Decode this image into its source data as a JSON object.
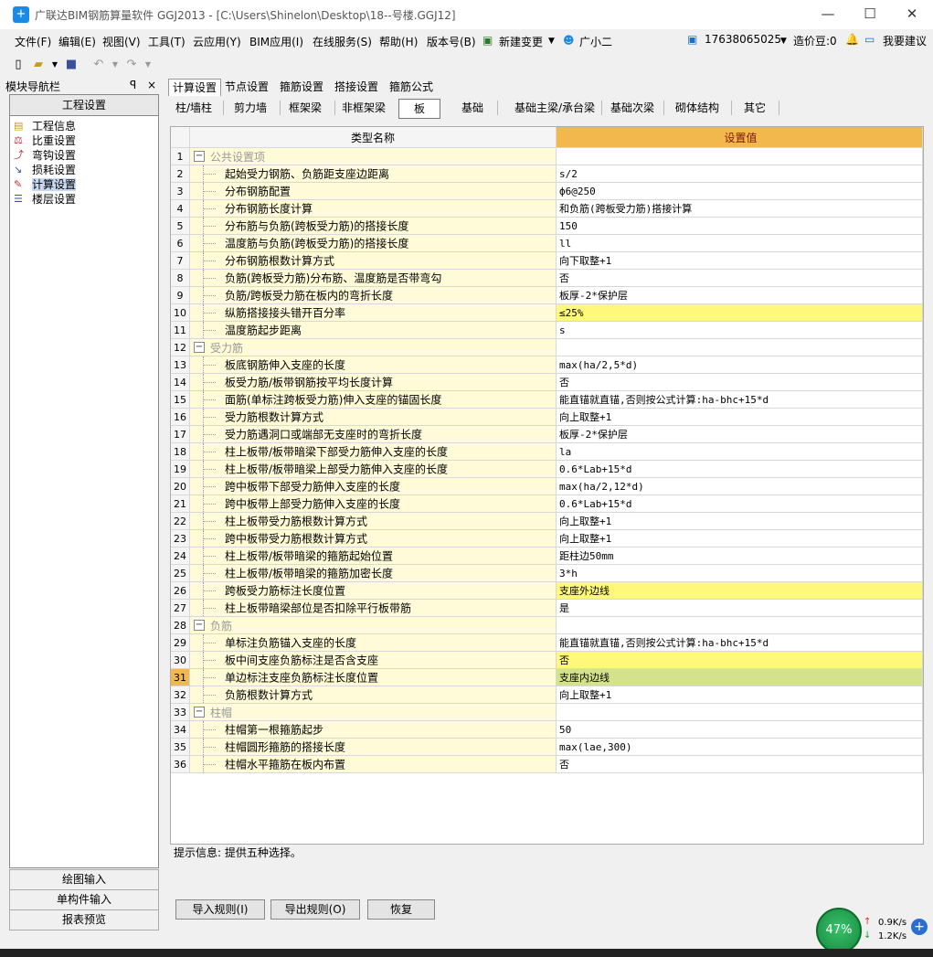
{
  "window": {
    "title": "广联达BIM钢筋算量软件 GGJ2013 - [C:\\Users\\Shinelon\\Desktop\\18--号楼.GGJ12]",
    "minimize": "—",
    "maximize": "☐",
    "close": "✕"
  },
  "menu": {
    "items": [
      "文件(F)",
      "编辑(E)",
      "视图(V)",
      "工具(T)",
      "云应用(Y)",
      "BIM应用(I)",
      "在线服务(S)",
      "帮助(H)",
      "版本号(B)",
      "新建变更",
      "广小二"
    ],
    "phone": "17638065025",
    "beans": "造价豆:0",
    "suggest": "我要建议"
  },
  "nav": {
    "title": "模块导航栏",
    "pin": "ᵠ",
    "close": "×",
    "section": "工程设置",
    "items": [
      "工程信息",
      "比重设置",
      "弯钩设置",
      "损耗设置",
      "计算设置",
      "楼层设置"
    ],
    "bottom": [
      "绘图输入",
      "单构件输入",
      "报表预览"
    ]
  },
  "tabs1": [
    "计算设置",
    "节点设置",
    "箍筋设置",
    "搭接设置",
    "箍筋公式"
  ],
  "tabs2": [
    "柱/墙柱",
    "剪力墙",
    "框架梁",
    "非框架梁",
    "板",
    "基础",
    "基础主梁/承台梁",
    "基础次梁",
    "砌体结构",
    "其它"
  ],
  "grid": {
    "header_name": "类型名称",
    "header_value": "设置值",
    "rows": [
      {
        "n": "1",
        "name": "公共设置项",
        "value": "",
        "group": true
      },
      {
        "n": "2",
        "name": "起始受力钢筋、负筋距支座边距离",
        "value": "s/2"
      },
      {
        "n": "3",
        "name": "分布钢筋配置",
        "value": "ф6@250"
      },
      {
        "n": "4",
        "name": "分布钢筋长度计算",
        "value": "和负筋(跨板受力筋)搭接计算"
      },
      {
        "n": "5",
        "name": "分布筋与负筋(跨板受力筋)的搭接长度",
        "value": "150"
      },
      {
        "n": "6",
        "name": "温度筋与负筋(跨板受力筋)的搭接长度",
        "value": "ll"
      },
      {
        "n": "7",
        "name": "分布钢筋根数计算方式",
        "value": "向下取整+1"
      },
      {
        "n": "8",
        "name": "负筋(跨板受力筋)分布筋、温度筋是否带弯勾",
        "value": "否"
      },
      {
        "n": "9",
        "name": "负筋/跨板受力筋在板内的弯折长度",
        "value": "板厚-2*保护层"
      },
      {
        "n": "10",
        "name": "纵筋搭接接头错开百分率",
        "value": "≤25%",
        "hl": "yellow"
      },
      {
        "n": "11",
        "name": "温度筋起步距离",
        "value": "s"
      },
      {
        "n": "12",
        "name": "受力筋",
        "value": "",
        "group": true
      },
      {
        "n": "13",
        "name": "板底钢筋伸入支座的长度",
        "value": "max(ha/2,5*d)"
      },
      {
        "n": "14",
        "name": "板受力筋/板带钢筋按平均长度计算",
        "value": "否"
      },
      {
        "n": "15",
        "name": "面筋(单标注跨板受力筋)伸入支座的锚固长度",
        "value": "能直锚就直锚,否则按公式计算:ha-bhc+15*d"
      },
      {
        "n": "16",
        "name": "受力筋根数计算方式",
        "value": "向上取整+1"
      },
      {
        "n": "17",
        "name": "受力筋遇洞口或端部无支座时的弯折长度",
        "value": "板厚-2*保护层"
      },
      {
        "n": "18",
        "name": "柱上板带/板带暗梁下部受力筋伸入支座的长度",
        "value": "la"
      },
      {
        "n": "19",
        "name": "柱上板带/板带暗梁上部受力筋伸入支座的长度",
        "value": "0.6*Lab+15*d"
      },
      {
        "n": "20",
        "name": "跨中板带下部受力筋伸入支座的长度",
        "value": "max(ha/2,12*d)"
      },
      {
        "n": "21",
        "name": "跨中板带上部受力筋伸入支座的长度",
        "value": "0.6*Lab+15*d"
      },
      {
        "n": "22",
        "name": "柱上板带受力筋根数计算方式",
        "value": "向上取整+1"
      },
      {
        "n": "23",
        "name": "跨中板带受力筋根数计算方式",
        "value": "向上取整+1"
      },
      {
        "n": "24",
        "name": "柱上板带/板带暗梁的箍筋起始位置",
        "value": "距柱边50mm"
      },
      {
        "n": "25",
        "name": "柱上板带/板带暗梁的箍筋加密长度",
        "value": "3*h"
      },
      {
        "n": "26",
        "name": "跨板受力筋标注长度位置",
        "value": "支座外边线",
        "hl": "yellow"
      },
      {
        "n": "27",
        "name": "柱上板带暗梁部位是否扣除平行板带筋",
        "value": "是"
      },
      {
        "n": "28",
        "name": "负筋",
        "value": "",
        "group": true
      },
      {
        "n": "29",
        "name": "单标注负筋锚入支座的长度",
        "value": "能直锚就直锚,否则按公式计算:ha-bhc+15*d"
      },
      {
        "n": "30",
        "name": "板中间支座负筋标注是否含支座",
        "value": "否",
        "hl": "yellow"
      },
      {
        "n": "31",
        "name": "单边标注支座负筋标注长度位置",
        "value": "支座内边线",
        "hl": "green",
        "current": true
      },
      {
        "n": "32",
        "name": "负筋根数计算方式",
        "value": "向上取整+1"
      },
      {
        "n": "33",
        "name": "柱帽",
        "value": "",
        "group": true
      },
      {
        "n": "34",
        "name": "柱帽第一根箍筋起步",
        "value": "50"
      },
      {
        "n": "35",
        "name": "柱帽圆形箍筋的搭接长度",
        "value": "max(lae,300)"
      },
      {
        "n": "36",
        "name": "柱帽水平箍筋在板内布置",
        "value": "否"
      }
    ]
  },
  "hint": "提示信息: 提供五种选择。",
  "buttons": [
    "导入规则(I)",
    "导出规则(O)",
    "恢复"
  ],
  "network": {
    "percent": "47%",
    "up": "0.9K/s",
    "down": "1.2K/s"
  },
  "colors": {
    "header_value_bg": "#f2b84e",
    "name_col_bg": "#fffbd8",
    "highlight_yellow": "#fff87a",
    "highlight_green": "#d4e28c"
  }
}
